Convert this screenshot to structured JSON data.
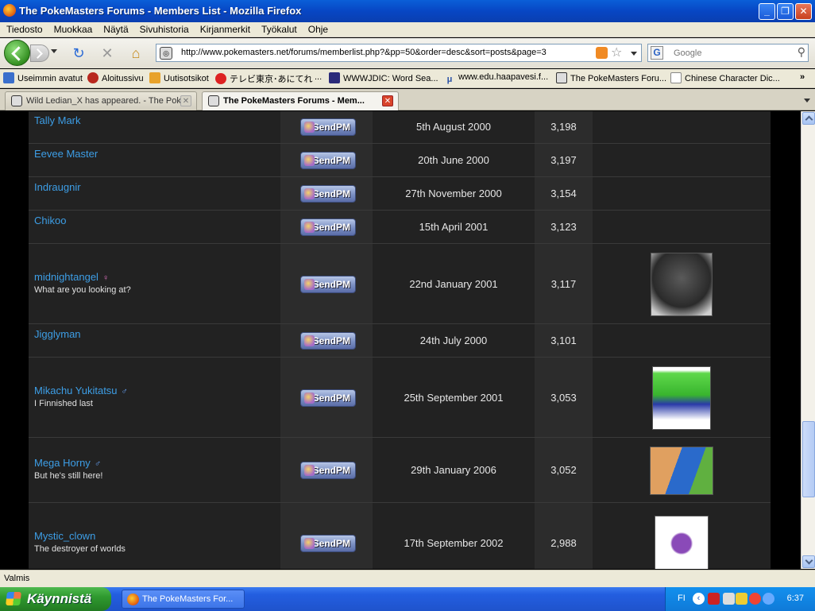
{
  "window": {
    "title": "The PokeMasters Forums - Members List - Mozilla Firefox"
  },
  "menu": [
    "Tiedosto",
    "Muokkaa",
    "Näytä",
    "Sivuhistoria",
    "Kirjanmerkit",
    "Työkalut",
    "Ohje"
  ],
  "nav": {
    "url": "http://www.pokemasters.net/forums/memberlist.php?&pp=50&order=desc&sort=posts&page=3",
    "search_placeholder": "Google"
  },
  "bookmarks": [
    "Useimmin avatut",
    "Aloitussivu",
    "Uutisotsikot",
    "テレビ東京･あにてれ",
    "...",
    "WWWJDIC: Word Sea...",
    "www.edu.haapavesi.f...",
    "The PokeMasters Foru...",
    "Chinese Character Dic..."
  ],
  "tabs": [
    {
      "label": "Wild Ledian_X has appeared. - The Pok...",
      "active": false
    },
    {
      "label": "The PokeMasters Forums - Mem...",
      "active": true
    }
  ],
  "members": [
    {
      "name": "Tally Mark",
      "title": "",
      "gender": "",
      "pm_label": "SendPM",
      "joined": "5th August 2000",
      "posts": "3,198",
      "avatar": ""
    },
    {
      "name": "Eevee Master",
      "title": "",
      "gender": "",
      "pm_label": "SendPM",
      "joined": "20th June 2000",
      "posts": "3,197",
      "avatar": ""
    },
    {
      "name": "Indraugnir",
      "title": "",
      "gender": "",
      "pm_label": "SendPM",
      "joined": "27th November 2000",
      "posts": "3,154",
      "avatar": ""
    },
    {
      "name": "Chikoo",
      "title": "",
      "gender": "",
      "pm_label": "SendPM",
      "joined": "15th April 2001",
      "posts": "3,123",
      "avatar": ""
    },
    {
      "name": "midnightangel",
      "title": "What are you looking at?",
      "gender": "female",
      "pm_label": "SendPM",
      "joined": "22nd January 2001",
      "posts": "3,117",
      "avatar": "cat"
    },
    {
      "name": "Jigglyman",
      "title": "",
      "gender": "",
      "pm_label": "SendPM",
      "joined": "24th July 2000",
      "posts": "3,101",
      "avatar": ""
    },
    {
      "name": "Mikachu Yukitatsu",
      "title": "I Finnished last",
      "gender": "male",
      "pm_label": "SendPM",
      "joined": "25th September 2001",
      "posts": "3,053",
      "avatar": "plant"
    },
    {
      "name": "Mega Horny",
      "title": "But he's still here!",
      "gender": "male",
      "pm_label": "SendPM",
      "joined": "29th January 2006",
      "posts": "3,052",
      "avatar": "fighter"
    },
    {
      "name": "Mystic_clown",
      "title": "The destroyer of worlds",
      "gender": "",
      "pm_label": "SendPM",
      "joined": "17th September 2002",
      "posts": "2,988",
      "avatar": "crystal"
    }
  ],
  "status": {
    "text": "Valmis"
  },
  "taskbar": {
    "start_label": "Käynnistä",
    "window_item": "The PokeMasters For...",
    "lang": "FI",
    "clock": "6:37"
  },
  "colors": {
    "username": "#3d9ee6",
    "row_bg": "#222222",
    "alt_col_bg": "#2c2c2c"
  }
}
